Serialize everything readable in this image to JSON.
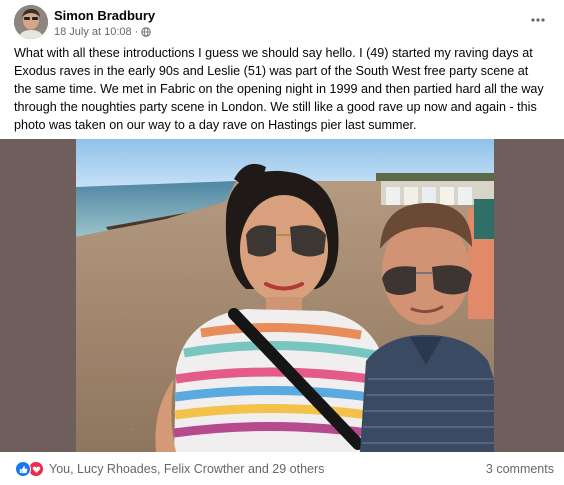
{
  "post": {
    "author": "Simon Bradbury",
    "date": "18 July at 10:08",
    "date_separator": "·",
    "privacy_icon": "globe-icon",
    "more_icon": "more-options-icon",
    "text_lines": [
      "What with all these introductions I guess we should say hello. I (49) started my raving days at",
      "Exodus raves in the early 90s and Leslie (51) was part of the South West free party scene at",
      "the same time. We met in Fabric on the opening night in 1999 and then partied hard all the way",
      "through the noughties party scene in London. We still like a good rave up now and again - this",
      "photo was taken on our way to a day rave on Hastings pier last summer."
    ]
  },
  "reactions": {
    "icons": [
      "like-icon",
      "love-icon"
    ],
    "summary": "You, Lucy Rhoades, Felix Crowther and 29 others"
  },
  "comments": {
    "count_label": "3 comments"
  },
  "colors": {
    "like": "#1877f2",
    "love": "#f0284a",
    "secondary_text": "#65676b",
    "photo_matte": "#6f5f5c"
  }
}
